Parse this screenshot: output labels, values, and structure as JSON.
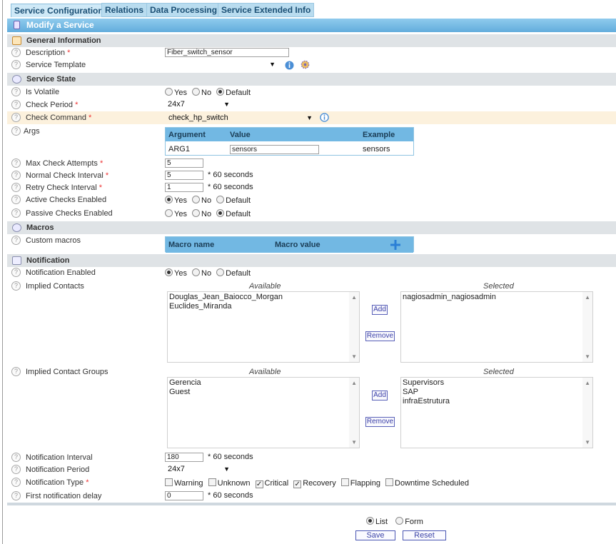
{
  "tabs": [
    "Service Configuration",
    "Relations",
    "Data Processing",
    "Service Extended Info"
  ],
  "header": {
    "title": "Modify a Service"
  },
  "sections": {
    "general": "General Information",
    "state": "Service State",
    "macros": "Macros",
    "notification": "Notification"
  },
  "fields": {
    "description": {
      "label": "Description",
      "value": "Fiber_switch_sensor"
    },
    "template": {
      "label": "Service Template",
      "value": ""
    },
    "volatile": {
      "label": "Is Volatile"
    },
    "check_period": {
      "label": "Check Period",
      "value": "24x7"
    },
    "check_command": {
      "label": "Check Command",
      "value": "check_hp_switch"
    },
    "args": {
      "label": "Args"
    },
    "max_attempts": {
      "label": "Max Check Attempts",
      "value": "5"
    },
    "normal_interval": {
      "label": "Normal Check Interval",
      "value": "5"
    },
    "retry_interval": {
      "label": "Retry Check Interval",
      "value": "1"
    },
    "active_checks": {
      "label": "Active Checks Enabled"
    },
    "passive_checks": {
      "label": "Passive Checks Enabled"
    },
    "custom_macros": {
      "label": "Custom macros"
    },
    "notif_enabled": {
      "label": "Notification Enabled"
    },
    "implied_contacts": {
      "label": "Implied Contacts"
    },
    "implied_groups": {
      "label": "Implied Contact Groups"
    },
    "notif_interval": {
      "label": "Notification Interval",
      "value": "180"
    },
    "notif_period": {
      "label": "Notification Period",
      "value": "24x7"
    },
    "notif_type": {
      "label": "Notification Type"
    },
    "first_delay": {
      "label": "First notification delay",
      "value": "0"
    }
  },
  "radio": {
    "yes": "Yes",
    "no": "No",
    "default": "Default"
  },
  "suffix": "* 60 seconds",
  "args_table": {
    "headers": [
      "Argument",
      "Value",
      "Example"
    ],
    "row": [
      "ARG1",
      "sensors",
      "sensors"
    ]
  },
  "macro_table": {
    "headers": [
      "Macro name",
      "Macro value"
    ]
  },
  "lists": {
    "available_label": "Available",
    "selected_label": "Selected",
    "add": "Add",
    "remove": "Remove",
    "contacts_available": [
      "Douglas_Jean_Baiocco_Morgan",
      "Euclides_Miranda"
    ],
    "contacts_selected": [
      "nagiosadmin_nagiosadmin"
    ],
    "groups_available": [
      "Gerencia",
      "Guest"
    ],
    "groups_selected": [
      "Supervisors",
      "SAP",
      "infraEstrutura"
    ]
  },
  "notif_types": [
    "Warning",
    "Unknown",
    "Critical",
    "Recovery",
    "Flapping",
    "Downtime Scheduled"
  ],
  "footer": {
    "list": "List",
    "form": "Form",
    "save": "Save",
    "reset": "Reset"
  }
}
